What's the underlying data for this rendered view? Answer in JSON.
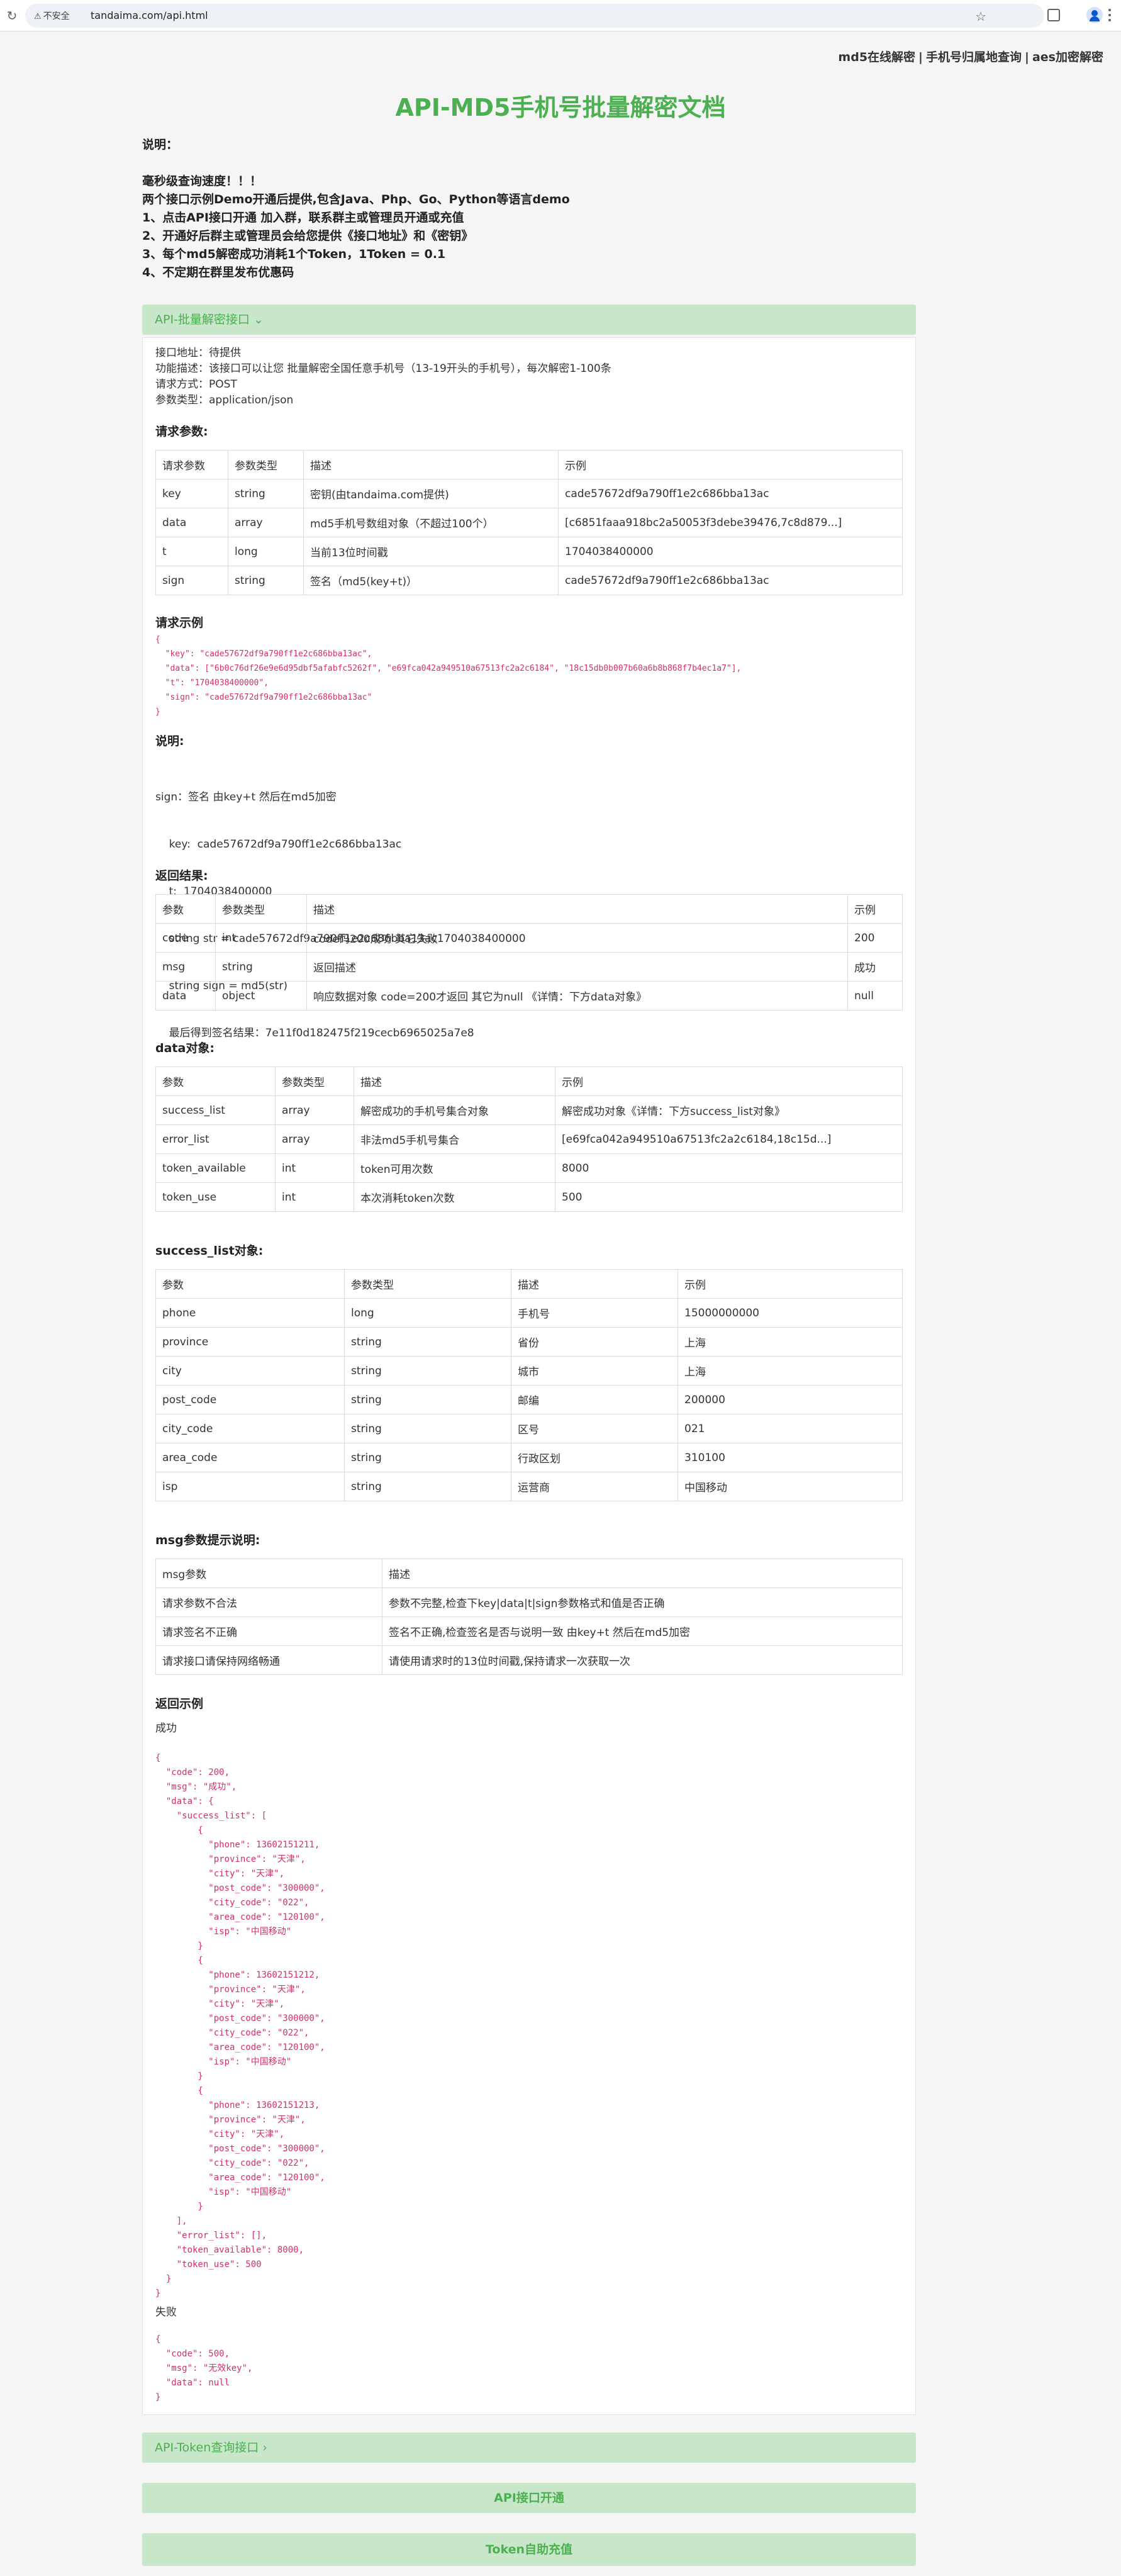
{
  "browser": {
    "security_label": "不安全",
    "url": "tandaima.com/api.html"
  },
  "toplinks": [
    {
      "label": "md5在线解密"
    },
    {
      "label": "手机号归属地查询"
    },
    {
      "label": "aes加密解密"
    }
  ],
  "title": "API-MD5手机号批量解密文档",
  "intro": {
    "heading": "说明：",
    "lines": [
      "毫秒级查询速度！！！",
      "两个接口示例Demo开通后提供,包含Java、Php、Go、Python等语言demo",
      "1、点击API接口开通 加入群，联系群主或管理员开通或充值",
      "2、开通好后群主或管理员会给您提供《接口地址》和《密钥》",
      "3、每个md5解密成功消耗1个Token，1Token = 0.1",
      "4、不定期在群里发布优惠码"
    ]
  },
  "panel1": {
    "header": "API-批量解密接口 ⌄",
    "meta": [
      "接口地址：待提供",
      "功能描述：该接口可以让您 批量解密全国任意手机号（13-19开头的手机号），每次解密1-100条",
      "请求方式：POST",
      "参数类型：application/json"
    ],
    "req_title": "请求参数:",
    "req_table": {
      "headers": [
        "请求参数",
        "参数类型",
        "描述",
        "示例"
      ],
      "rows": [
        [
          "key",
          "string",
          "密钥(由tandaima.com提供)",
          "cade57672df9a790ff1e2c686bba13ac"
        ],
        [
          "data",
          "array",
          "md5手机号数组对象（不超过100个）",
          "[c6851faaa918bc2a50053f3debe39476,7c8d879...]"
        ],
        [
          "t",
          "long",
          "当前13位时间戳",
          "1704038400000"
        ],
        [
          "sign",
          "string",
          "签名（md5(key+t)）",
          "cade57672df9a790ff1e2c686bba13ac"
        ]
      ]
    },
    "example_title": "请求示例",
    "example_code": "{\n  \"key\": \"cade57672df9a790ff1e2c686bba13ac\",\n  \"data\": [\"6b0c76df26e9e6d95dbf5afabfc5262f\", \"e69fca042a949510a67513fc2a2c6184\", \"18c15db0b007b60a6b8b868f7b4ec1a7\"],\n  \"t\": \"1704038400000\",\n  \"sign\": \"cade57672df9a790ff1e2c686bba13ac\"\n}",
    "note_title": "说明:",
    "note_lines": [
      "sign：签名 由key+t 然后在md5加密",
      "    key:  cade57672df9a790ff1e2c686bba13ac",
      "    t:  1704038400000",
      "    string str = cade57672df9a790ff1e2c686bba13ac1704038400000",
      "    string sign = md5(str)",
      "    最后得到签名结果：7e11f0d182475f219cecb6965025a7e8"
    ],
    "ret_title": "返回结果:",
    "ret_table": {
      "headers": [
        "参数",
        "参数类型",
        "描述",
        "示例"
      ],
      "rows": [
        [
          "code",
          "int",
          "code码200成功 其它失败",
          "200"
        ],
        [
          "msg",
          "string",
          "返回描述",
          "成功"
        ],
        [
          "data",
          "object",
          "响应数据对象 code=200才返回 其它为null 《详情：下方data对象》",
          "null"
        ]
      ]
    },
    "data_title": "data对象:",
    "data_table": {
      "headers": [
        "参数",
        "参数类型",
        "描述",
        "示例"
      ],
      "rows": [
        [
          "success_list",
          "array",
          "解密成功的手机号集合对象",
          "解密成功对象《详情：下方success_list对象》"
        ],
        [
          "error_list",
          "array",
          "非法md5手机号集合",
          "[e69fca042a949510a67513fc2a2c6184,18c15d...]"
        ],
        [
          "token_available",
          "int",
          "token可用次数",
          "8000"
        ],
        [
          "token_use",
          "int",
          "本次消耗token次数",
          "500"
        ]
      ]
    },
    "sl_title": "success_list对象:",
    "sl_table": {
      "headers": [
        "参数",
        "参数类型",
        "描述",
        "示例"
      ],
      "rows": [
        [
          "phone",
          "long",
          "手机号",
          "15000000000"
        ],
        [
          "province",
          "string",
          "省份",
          "上海"
        ],
        [
          "city",
          "string",
          "城市",
          "上海"
        ],
        [
          "post_code",
          "string",
          "邮编",
          "200000"
        ],
        [
          "city_code",
          "string",
          "区号",
          "021"
        ],
        [
          "area_code",
          "string",
          "行政区划",
          "310100"
        ],
        [
          "isp",
          "string",
          "运营商",
          "中国移动"
        ]
      ]
    },
    "msg_title": "msg参数提示说明:",
    "msg_table": {
      "headers": [
        "msg参数",
        "描述"
      ],
      "rows": [
        [
          "请求参数不合法",
          "参数不完整,检查下key|data|t|sign参数格式和值是否正确"
        ],
        [
          "请求签名不正确",
          "签名不正确,检查签名是否与说明一致 由key+t 然后在md5加密"
        ],
        [
          "请求接口请保持网络畅通",
          "请使用请求时的13位时间戳,保持请求一次获取一次"
        ]
      ]
    },
    "resp_title": "返回示例",
    "success_label": "成功",
    "success_code": "{\n  \"code\": 200,\n  \"msg\": \"成功\",\n  \"data\": {\n    \"success_list\": [\n        {\n          \"phone\": 13602151211,\n          \"province\": \"天津\",\n          \"city\": \"天津\",\n          \"post_code\": \"300000\",\n          \"city_code\": \"022\",\n          \"area_code\": \"120100\",\n          \"isp\": \"中国移动\"\n        }\n        {\n          \"phone\": 13602151212,\n          \"province\": \"天津\",\n          \"city\": \"天津\",\n          \"post_code\": \"300000\",\n          \"city_code\": \"022\",\n          \"area_code\": \"120100\",\n          \"isp\": \"中国移动\"\n        }\n        {\n          \"phone\": 13602151213,\n          \"province\": \"天津\",\n          \"city\": \"天津\",\n          \"post_code\": \"300000\",\n          \"city_code\": \"022\",\n          \"area_code\": \"120100\",\n          \"isp\": \"中国移动\"\n        }\n    ],\n    \"error_list\": [],\n    \"token_available\": 8000,\n    \"token_use\": 500\n  }\n}",
    "fail_label": "失败",
    "fail_code": "{\n  \"code\": 500,\n  \"msg\": \"无效key\",\n  \"data\": null\n}"
  },
  "panel2": {
    "header": "API-Token查询接口 ›"
  },
  "btn_open": {
    "label": "API接口开通"
  },
  "btn_recharge": {
    "label": "Token自助充值"
  }
}
